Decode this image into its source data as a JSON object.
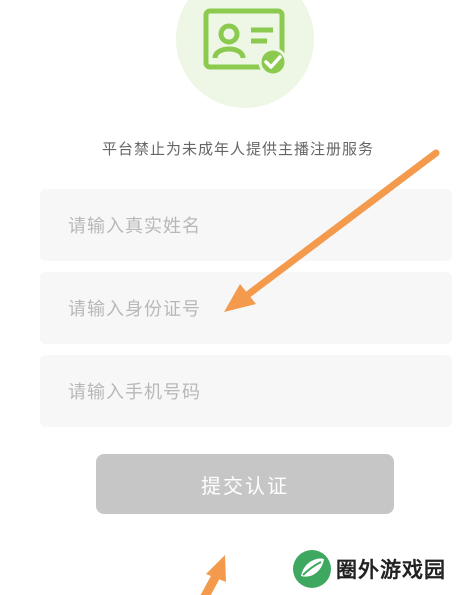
{
  "notice": "平台禁止为未成年人提供主播注册服务",
  "fields": {
    "name_placeholder": "请输入真实姓名",
    "id_placeholder": "请输入身份证号",
    "phone_placeholder": "请输入手机号码"
  },
  "submit_label": "提交认证",
  "watermark": "圈外游戏园",
  "icons": {
    "header": "id-card-verified-icon",
    "watermark": "leaf-logo-icon"
  },
  "colors": {
    "brand_green": "#8cc94f",
    "badge_bg": "#eef6e6",
    "field_bg": "#f7f7f7",
    "button_disabled": "#c6c6c6",
    "annotation_arrow": "#f39a4c",
    "watermark_green": "#3ea860"
  }
}
